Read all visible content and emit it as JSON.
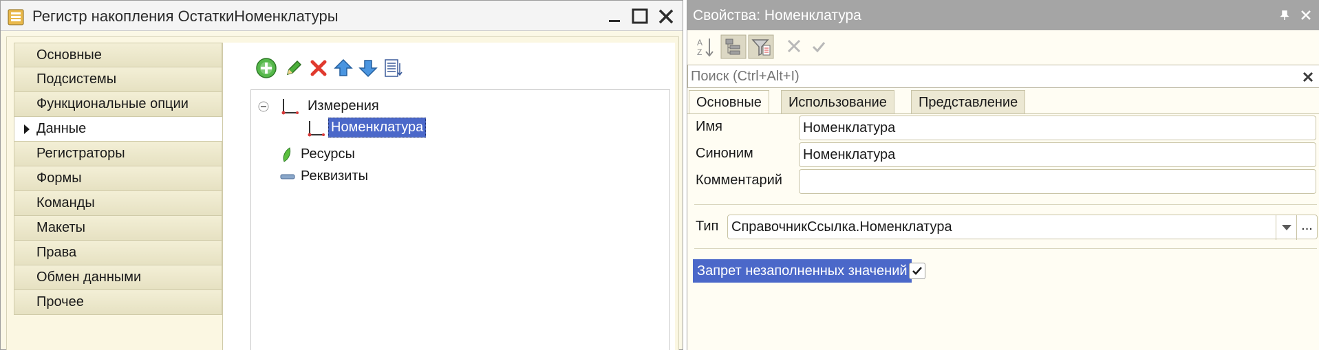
{
  "left_window": {
    "title": "Регистр накопления ОстаткиНоменклатуры",
    "controls": {
      "minimize": "minimize-icon",
      "maximize": "maximize-icon",
      "close": "close-icon"
    },
    "sections": [
      {
        "label": "Основные"
      },
      {
        "label": "Подсистемы"
      },
      {
        "label": "Функциональные опции"
      },
      {
        "label": "Данные",
        "active": true
      },
      {
        "label": "Регистраторы"
      },
      {
        "label": "Формы"
      },
      {
        "label": "Команды"
      },
      {
        "label": "Макеты"
      },
      {
        "label": "Права"
      },
      {
        "label": "Обмен данными"
      },
      {
        "label": "Прочее"
      }
    ],
    "toolbar": [
      "add-icon",
      "edit-pencil-icon",
      "delete-icon",
      "move-up-icon",
      "move-down-icon",
      "list-icon"
    ],
    "tree": {
      "dimensions": "Измерения",
      "dimension_item": "Номенклатура",
      "resources": "Ресурсы",
      "attributes": "Реквизиты"
    }
  },
  "properties": {
    "title": "Свойства: Номенклатура",
    "toolbar": [
      "sort-az-icon",
      "category-view-icon",
      "filter-icon",
      "cancel-icon",
      "apply-check-icon"
    ],
    "search": {
      "placeholder": "Поиск (Ctrl+Alt+I)"
    },
    "tabs": [
      {
        "label": "Основные",
        "active": true
      },
      {
        "label": "Использование"
      },
      {
        "label": "Представление"
      }
    ],
    "fields": {
      "name_label": "Имя",
      "name_value": "Номенклатура",
      "synonym_label": "Синоним",
      "synonym_value": "Номенклатура",
      "comment_label": "Комментарий",
      "comment_value": "",
      "type_label": "Тип",
      "type_value": "СправочникСсылка.Номенклатура",
      "type_more": "...",
      "fill_check_label": "Запрет незаполненных значений",
      "fill_check_checked": true
    }
  },
  "colors": {
    "selection": "#4b68c9",
    "panel_bg": "#fbf7e2",
    "properties_title_bg": "#a5a5a5",
    "delete_red": "#e03a2e",
    "add_green": "#3aa23a",
    "arrow_blue": "#3a86d6"
  }
}
